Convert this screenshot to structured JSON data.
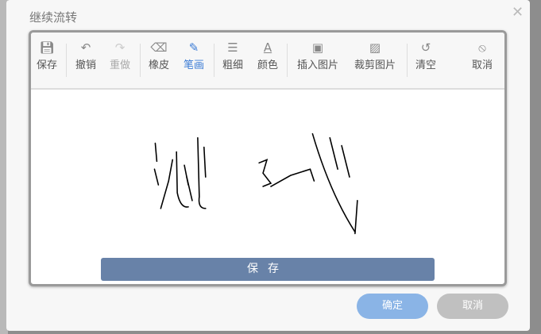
{
  "dialog": {
    "title": "继续流转",
    "close_icon": "close-icon"
  },
  "toolbar": {
    "items": [
      {
        "label": "保存",
        "icon": "save-icon"
      },
      {
        "label": "撤销",
        "icon": "undo-icon"
      },
      {
        "label": "重做",
        "icon": "redo-icon"
      },
      {
        "label": "橡皮",
        "icon": "eraser-icon"
      },
      {
        "label": "笔画",
        "icon": "pen-icon"
      },
      {
        "label": "粗细",
        "icon": "line-width-icon"
      },
      {
        "label": "颜色",
        "icon": "font-color-icon"
      },
      {
        "label": "插入图片",
        "icon": "image-icon"
      },
      {
        "label": "裁剪图片",
        "icon": "crop-image-icon"
      },
      {
        "label": "清空",
        "icon": "clear-icon"
      },
      {
        "label": "取消",
        "icon": "cancel-icon"
      }
    ]
  },
  "pad": {
    "save_label": "保存",
    "handwriting": "测试"
  },
  "footer": {
    "ok_label": "确定",
    "cancel_label": "取消"
  },
  "colors": {
    "save": "#6882a8",
    "ok": "#8ab4e6",
    "cancel": "#c0c0c0",
    "active": "#3a7bd5"
  }
}
